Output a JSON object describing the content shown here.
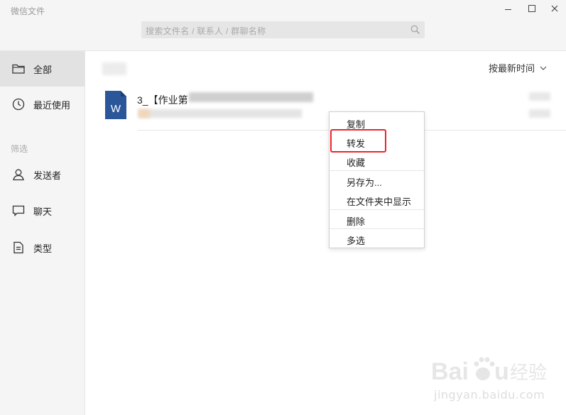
{
  "window": {
    "title": "微信文件"
  },
  "search": {
    "placeholder": "搜索文件名 / 联系人 / 群聊名称"
  },
  "sidebar": {
    "items": [
      {
        "label": "全部",
        "icon": "folder-icon"
      },
      {
        "label": "最近使用",
        "icon": "clock-icon"
      }
    ],
    "filter_heading": "筛选",
    "filters": [
      {
        "label": "发送者",
        "icon": "person-icon"
      },
      {
        "label": "聊天",
        "icon": "chat-icon"
      },
      {
        "label": "类型",
        "icon": "document-icon"
      }
    ]
  },
  "main": {
    "sort_label": "按最新时间",
    "files": [
      {
        "name": "3_【作业第",
        "type_icon": "word-icon",
        "icon_letter": "W",
        "icon_color": "#2b579a"
      }
    ]
  },
  "context_menu": {
    "items": [
      "复制",
      "转发",
      "收藏",
      "另存为...",
      "在文件夹中显示",
      "删除",
      "多选"
    ],
    "highlighted": "转发",
    "highlight_color": "#e8262b"
  },
  "watermark": {
    "brand": "Baidu经验",
    "url": "jingyan.baidu.com"
  }
}
